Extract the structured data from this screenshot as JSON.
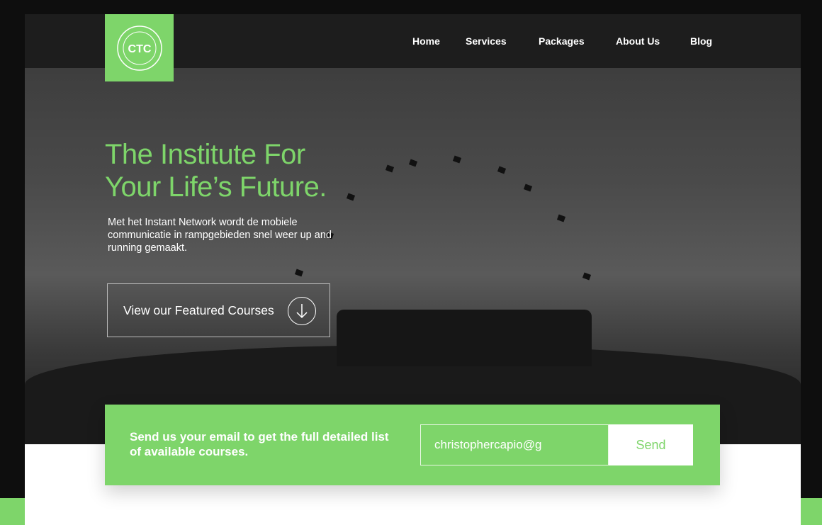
{
  "logo": {
    "text": "CTC",
    "ring_text": "STATE UNIVERSITY"
  },
  "nav": [
    {
      "label": "Home"
    },
    {
      "label": "Services"
    },
    {
      "label": "Packages"
    },
    {
      "label": "About Us"
    },
    {
      "label": "Blog"
    }
  ],
  "hero": {
    "title_line1": "The Institute For",
    "title_line2": "Your Life’s Future.",
    "description": "Met het Instant Network wordt de mobiele communicatie in rampgebieden snel weer up and running gemaakt.",
    "cta_label": "View our Featured Courses",
    "cta_icon": "arrow-down-icon"
  },
  "subscribe": {
    "text": "Send us your email to get the full detailed list of available courses.",
    "email_value": "christophercapio@g",
    "button_label": "Send"
  },
  "colors": {
    "accent": "#7ed56a",
    "header": "#1d1d1d"
  }
}
